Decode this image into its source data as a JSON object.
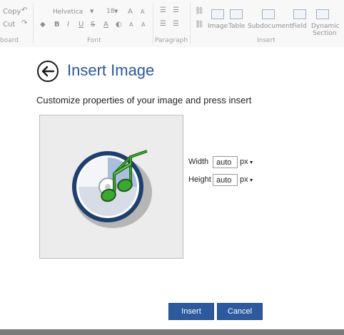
{
  "ribbon": {
    "clipboard": {
      "copy": "Copy",
      "cut": "Cut",
      "group_label": "board"
    },
    "font": {
      "family": "Helvetica",
      "size": "18",
      "group_label": "Font"
    },
    "paragraph": {
      "group_label": "Paragraph"
    },
    "insert": {
      "group_label": "Insert",
      "items": [
        "Image",
        "Table",
        "Subdocument",
        "Field",
        "Dynamic",
        "Section"
      ]
    }
  },
  "dialog": {
    "title": "Insert Image",
    "subtitle": "Customize properties of your image and press insert",
    "width": {
      "label": "Width",
      "value": "auto",
      "unit": "px"
    },
    "height": {
      "label": "Height",
      "value": "auto",
      "unit": "px"
    },
    "insert_button": "Insert",
    "cancel_button": "Cancel"
  },
  "colors": {
    "accent": "#2b579a",
    "button": "#2d5a9e",
    "music_note": "#3aa832"
  },
  "icons": [
    "back-arrow-icon",
    "music-cd-icon"
  ]
}
